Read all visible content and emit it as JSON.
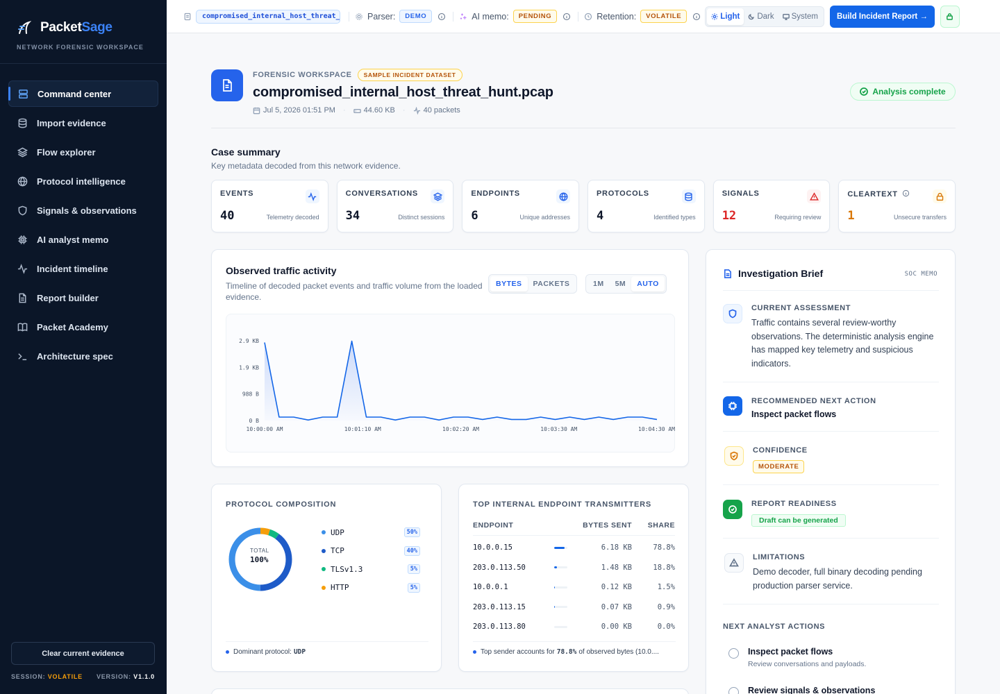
{
  "brand": {
    "name_main": "Packet",
    "name_accent": "Sage",
    "subtitle": "NETWORK FORENSIC WORKSPACE"
  },
  "colors": {
    "accent": "#2563eb",
    "sidebar_bg": "#0b1628",
    "success": "#16a34a",
    "warning": "#f59e0b",
    "danger": "#dc2626"
  },
  "sidebar": {
    "items": [
      {
        "label": "Command center",
        "icon": "server-icon",
        "active": true
      },
      {
        "label": "Import evidence",
        "icon": "database-icon"
      },
      {
        "label": "Flow explorer",
        "icon": "layers-icon"
      },
      {
        "label": "Protocol intelligence",
        "icon": "globe-icon"
      },
      {
        "label": "Signals & observations",
        "icon": "shield-icon"
      },
      {
        "label": "AI analyst memo",
        "icon": "cpu-icon"
      },
      {
        "label": "Incident timeline",
        "icon": "activity-icon"
      },
      {
        "label": "Report builder",
        "icon": "file-icon"
      },
      {
        "label": "Packet Academy",
        "icon": "book-icon"
      },
      {
        "label": "Architecture spec",
        "icon": "terminal-icon"
      }
    ],
    "clear_label": "Clear current evidence",
    "session_label": "SESSION:",
    "session_value": "VOLATILE",
    "version_label": "VERSION:",
    "version_value": "V1.1.0"
  },
  "topbar": {
    "file_name": "compromised_internal_host_threat_hunt.pcap",
    "parser_label": "Parser:",
    "parser_value": "DEMO",
    "memo_label": "AI memo:",
    "memo_value": "PENDING",
    "retention_label": "Retention:",
    "retention_value": "VOLATILE",
    "theme_options": [
      "Light",
      "Dark",
      "System"
    ],
    "theme_selected": "Light",
    "build_label": "Build Incident Report →"
  },
  "header": {
    "eyebrow": "FORENSIC WORKSPACE",
    "dataset_badge": "SAMPLE INCIDENT DATASET",
    "title": "compromised_internal_host_threat_hunt.pcap",
    "date": "Jul 5, 2026 01:51 PM",
    "size": "44.60 KB",
    "packets": "40 packets",
    "status": "Analysis complete"
  },
  "summary": {
    "title": "Case summary",
    "subtitle": "Key metadata decoded from this network evidence.",
    "cards": [
      {
        "label": "EVENTS",
        "value": "40",
        "caption": "Telemetry decoded",
        "icon": "activity-icon",
        "color": "#0f172a"
      },
      {
        "label": "CONVERSATIONS",
        "value": "34",
        "caption": "Distinct sessions",
        "icon": "layers-icon",
        "color": "#0f172a"
      },
      {
        "label": "ENDPOINTS",
        "value": "6",
        "caption": "Unique addresses",
        "icon": "globe-icon",
        "color": "#0f172a"
      },
      {
        "label": "PROTOCOLS",
        "value": "4",
        "caption": "Identified types",
        "icon": "database-icon",
        "color": "#0f172a"
      },
      {
        "label": "SIGNALS",
        "value": "12",
        "caption": "Requiring review",
        "icon": "alert-triangle-icon",
        "color": "#dc2626"
      },
      {
        "label": "CLEARTEXT",
        "value": "1",
        "caption": "Unsecure transfers",
        "icon": "lock-open-icon",
        "color": "#d97706"
      }
    ]
  },
  "traffic": {
    "title": "Observed traffic activity",
    "subtitle": "Timeline of decoded packet events and traffic volume from the loaded evidence.",
    "metric_options": [
      "BYTES",
      "PACKETS"
    ],
    "metric_selected": "BYTES",
    "range_options": [
      "1M",
      "5M",
      "AUTO"
    ],
    "range_selected": "AUTO"
  },
  "chart_data": {
    "type": "area",
    "y_tick_labels": [
      "0 B",
      "988 B",
      "1.9 KB",
      "2.9 KB"
    ],
    "y_tick_values": [
      0,
      988,
      1976,
      2964
    ],
    "x_tick_labels": [
      "10:00:00 AM",
      "10:01:10 AM",
      "10:02:20 AM",
      "10:03:30 AM",
      "10:04:30 AM"
    ],
    "ylim": [
      0,
      2964
    ],
    "x": [
      0,
      10,
      20,
      30,
      40,
      50,
      60,
      70,
      80,
      90,
      100,
      110,
      120,
      130,
      140,
      150,
      160,
      170,
      180,
      190,
      200,
      210,
      220,
      230,
      240,
      250,
      260,
      270
    ],
    "values": [
      2900,
      130,
      130,
      20,
      130,
      130,
      2950,
      130,
      130,
      20,
      130,
      130,
      20,
      130,
      130,
      40,
      130,
      40,
      40,
      130,
      40,
      130,
      40,
      130,
      40,
      130,
      130,
      40
    ],
    "grid": false
  },
  "protocols": {
    "title": "PROTOCOL COMPOSITION",
    "total_label": "TOTAL",
    "total_value": "100%",
    "items": [
      {
        "name": "UDP",
        "pct": "50%",
        "value": 50,
        "color": "#3b8fe8"
      },
      {
        "name": "TCP",
        "pct": "40%",
        "value": 40,
        "color": "#1e5bc8"
      },
      {
        "name": "TLSv1.3",
        "pct": "5%",
        "value": 5,
        "color": "#10b981"
      },
      {
        "name": "HTTP",
        "pct": "5%",
        "value": 5,
        "color": "#f59e0b"
      }
    ],
    "footer_label": "Dominant protocol:",
    "footer_value": "UDP"
  },
  "endpoints": {
    "title": "TOP INTERNAL ENDPOINT TRANSMITTERS",
    "headers": [
      "ENDPOINT",
      "BYTES SENT",
      "SHARE"
    ],
    "rows": [
      {
        "ip": "10.0.0.15",
        "bytes": "6.18 KB",
        "share": "78.8%",
        "share_value": 78.8
      },
      {
        "ip": "203.0.113.50",
        "bytes": "1.48 KB",
        "share": "18.8%",
        "share_value": 18.8
      },
      {
        "ip": "10.0.0.1",
        "bytes": "0.12 KB",
        "share": "1.5%",
        "share_value": 1.5
      },
      {
        "ip": "203.0.113.15",
        "bytes": "0.07 KB",
        "share": "0.9%",
        "share_value": 0.9
      },
      {
        "ip": "203.0.113.80",
        "bytes": "0.00 KB",
        "share": "0.0%",
        "share_value": 0.0
      }
    ],
    "footer_pre": "Top sender accounts for",
    "footer_value": "78.8%",
    "footer_post": "of observed bytes (10.0...."
  },
  "brief": {
    "title": "Investigation Brief",
    "tag": "SOC MEMO",
    "assessment_label": "CURRENT ASSESSMENT",
    "assessment_text": "Traffic contains several review-worthy observations. The deterministic analysis engine has mapped key telemetry and suspicious indicators.",
    "next_label": "RECOMMENDED NEXT ACTION",
    "next_value": "Inspect packet flows",
    "confidence_label": "CONFIDENCE",
    "confidence_value": "MODERATE",
    "readiness_label": "REPORT READINESS",
    "readiness_value": "Draft can be generated",
    "limitations_label": "LIMITATIONS",
    "limitations_text": "Demo decoder, full binary decoding pending production parser service.",
    "actions_title": "NEXT ANALYST ACTIONS",
    "actions": [
      {
        "title": "Inspect packet flows",
        "sub": "Review conversations and payloads."
      },
      {
        "title": "Review signals & observations",
        "sub": ""
      }
    ]
  }
}
